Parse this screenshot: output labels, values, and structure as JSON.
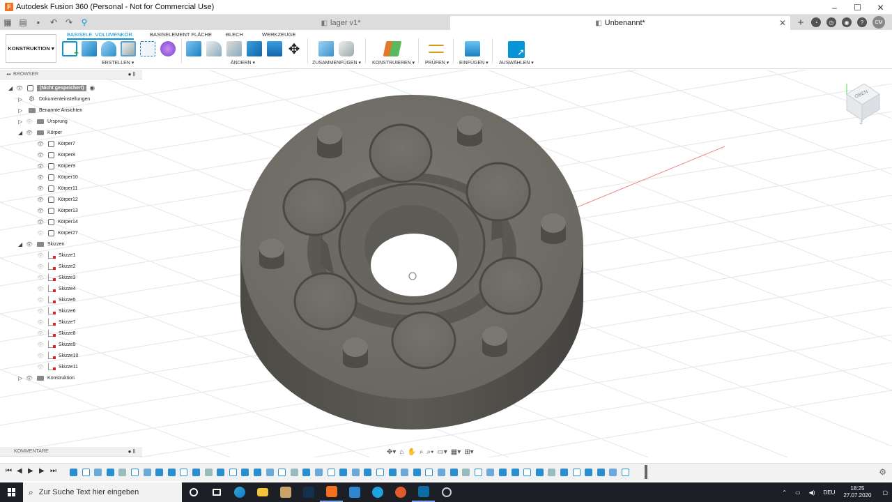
{
  "window": {
    "title": "Autodesk Fusion 360 (Personal - Not for Commercial Use)",
    "controls": [
      "–",
      "☐",
      "✕"
    ]
  },
  "tabs": {
    "doc1": "lager v1*",
    "doc2": "Unbenannt*",
    "user_initials": "CM"
  },
  "toolbar": {
    "workspace": "KONSTRUKTION ▾",
    "ribbon_tabs": [
      "BASISELE. VOLUMENKÖR.",
      "BASISELEMENT FLÄCHE",
      "BLECH",
      "WERKZEUGE"
    ],
    "groups": [
      "ERSTELLEN ▾",
      "ÄNDERN ▾",
      "ZUSAMMENFÜGEN ▾",
      "KONSTRUIEREN ▾",
      "PRÜFEN ▾",
      "EINFÜGEN ▾",
      "AUSWÄHLEN ▾"
    ]
  },
  "browser": {
    "title": "BROWSER",
    "root": "(Nicht gespeichert)",
    "items": [
      "Dokumenteinstellungen",
      "Benannte Ansichten",
      "Ursprung",
      "Körper",
      "Körper7",
      "Körper8",
      "Körper9",
      "Körper10",
      "Körper11",
      "Körper12",
      "Körper13",
      "Körper14",
      "Körper27",
      "Skizzen",
      "Skizze1",
      "Skizze2",
      "Skizze3",
      "Skizze4",
      "Skizze5",
      "Skizze6",
      "Skizze7",
      "Skizze8",
      "Skizze9",
      "Skizze10",
      "Skizze11",
      "Konstruktion"
    ]
  },
  "comments": {
    "title": "KOMMENTARE"
  },
  "viewcube": {
    "label": "OBEN"
  },
  "taskbar": {
    "search_placeholder": "Zur Suche Text hier eingeben",
    "language": "DEU",
    "time": "18:25",
    "date": "27.07.2020"
  },
  "colors": {
    "accent": "#0696d7",
    "model": "#6f6d66",
    "taskbar": "#1c1f26"
  }
}
